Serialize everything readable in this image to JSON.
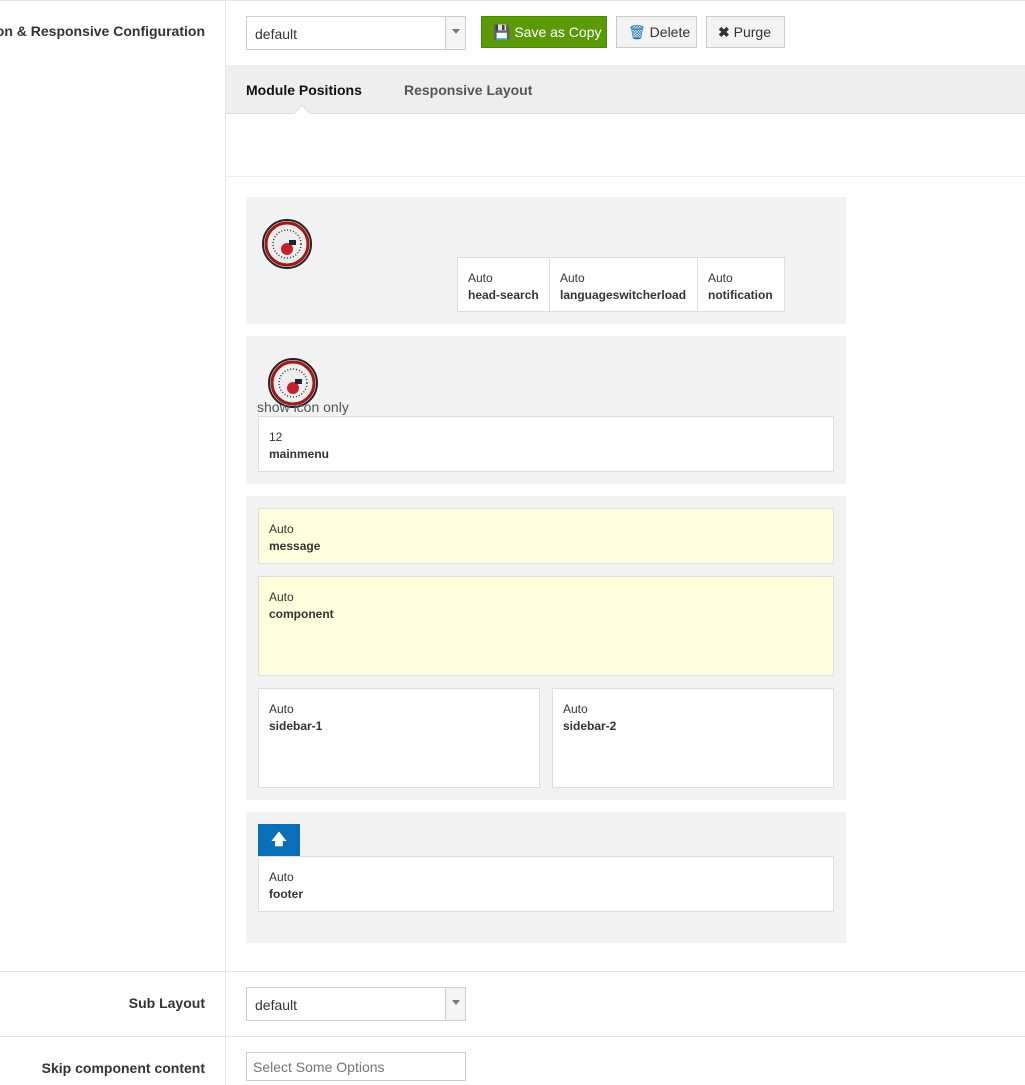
{
  "left": {
    "config_label": "on & Responsive Configuration",
    "sublayout_label": "Sub Layout",
    "skip_label": "Skip component content"
  },
  "toolbar": {
    "layout_value": "default",
    "save_copy": "Save as Copy",
    "delete": "Delete",
    "purge": "Purge"
  },
  "tabs": [
    "Module Positions",
    "Responsive Layout"
  ],
  "header": {
    "positions": [
      {
        "size": "Auto",
        "name": "head-search"
      },
      {
        "size": "Auto",
        "name": "languageswitcherload"
      },
      {
        "size": "Auto",
        "name": "notification"
      }
    ]
  },
  "nav": {
    "logo_text": "show icon only",
    "position": {
      "size": "12",
      "name": "mainmenu"
    }
  },
  "main": {
    "message": {
      "size": "Auto",
      "name": "message"
    },
    "component": {
      "size": "Auto",
      "name": "component"
    },
    "sidebar1": {
      "size": "Auto",
      "name": "sidebar-1"
    },
    "sidebar2": {
      "size": "Auto",
      "name": "sidebar-2"
    }
  },
  "footer": {
    "position": {
      "size": "Auto",
      "name": "footer"
    }
  },
  "sublayout": {
    "value": "default"
  },
  "skip": {
    "placeholder": "Select Some Options"
  },
  "colors": {
    "green": "#5a9a07",
    "blue": "#0a6fb8",
    "highlight": "#ffffdd"
  }
}
